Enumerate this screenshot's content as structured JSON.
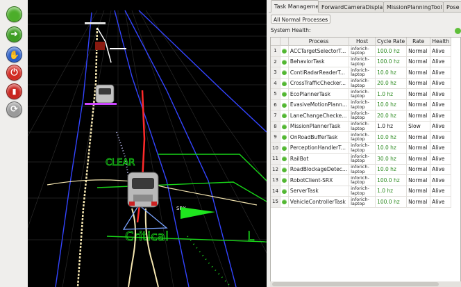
{
  "toolbar": {
    "buttons": [
      {
        "name": "go-button",
        "color": "#4cae2a",
        "icon": "circle-icon"
      },
      {
        "name": "forward-button",
        "color": "#3d9e23",
        "icon": "arrow-right-icon"
      },
      {
        "name": "pause-hand-button",
        "color": "#2a5ec8",
        "icon": "hand-icon"
      },
      {
        "name": "power-button",
        "color": "#d22a22",
        "icon": "power-icon"
      },
      {
        "name": "delete-button",
        "color": "#c8241e",
        "icon": "trash-icon"
      },
      {
        "name": "refresh-button",
        "color": "#9a9a9a",
        "icon": "refresh-icon"
      }
    ]
  },
  "viewport": {
    "clear_label": "CLEAR",
    "critical_label": "Critical",
    "lc_label": "L",
    "srx_label": "SRX"
  },
  "tabs": [
    {
      "label": "Task Management",
      "active": true
    },
    {
      "label": "ForwardCameraDisplay",
      "active": false
    },
    {
      "label": "MissionPlanningTool",
      "active": false
    },
    {
      "label": "Pose",
      "active": false
    }
  ],
  "filter": {
    "value": "All Normal Processes",
    "caret": "▾"
  },
  "system_health_label": "System Health:",
  "colors": {
    "healthy": "#52b731",
    "rate_ok": "#2c8a20"
  },
  "table": {
    "columns": [
      "",
      "Process",
      "Host",
      "Cycle Rate",
      "Rate",
      "Health"
    ],
    "rows": [
      {
        "num": "1",
        "process": "ACCTargetSelectorT...",
        "host": "inforich-laptop",
        "cycle": "100.0 hz",
        "rate": "Normal",
        "health": "Alive"
      },
      {
        "num": "2",
        "process": "BehaviorTask",
        "host": "inforich-laptop",
        "cycle": "100.0 hz",
        "rate": "Normal",
        "health": "Alive"
      },
      {
        "num": "3",
        "process": "ContiRadarReaderT...",
        "host": "inforich-laptop",
        "cycle": "10.0 hz",
        "rate": "Normal",
        "health": "Alive"
      },
      {
        "num": "4",
        "process": "CrossTrafficChecker...",
        "host": "inforich-laptop",
        "cycle": "20.0 hz",
        "rate": "Normal",
        "health": "Alive"
      },
      {
        "num": "5",
        "process": "EcoPlannerTask",
        "host": "inforich-laptop",
        "cycle": "1.0 hz",
        "rate": "Normal",
        "health": "Alive"
      },
      {
        "num": "6",
        "process": "EvasiveMotionPlann...",
        "host": "inforich-laptop",
        "cycle": "10.0 hz",
        "rate": "Normal",
        "health": "Alive"
      },
      {
        "num": "7",
        "process": "LaneChangeChecke...",
        "host": "inforich-laptop",
        "cycle": "20.0 hz",
        "rate": "Normal",
        "health": "Alive"
      },
      {
        "num": "8",
        "process": "MissionPlannerTask",
        "host": "inforich-laptop",
        "cycle": "1.0 hz",
        "rate": "Slow",
        "health": "Alive"
      },
      {
        "num": "9",
        "process": "OnRoadBufferTask",
        "host": "inforich-laptop",
        "cycle": "10.0 hz",
        "rate": "Normal",
        "health": "Alive"
      },
      {
        "num": "10",
        "process": "PerceptionHandlerT...",
        "host": "inforich-laptop",
        "cycle": "10.0 hz",
        "rate": "Normal",
        "health": "Alive"
      },
      {
        "num": "11",
        "process": "RailBot",
        "host": "inforich-laptop",
        "cycle": "30.0 hz",
        "rate": "Normal",
        "health": "Alive"
      },
      {
        "num": "12",
        "process": "RoadBlockageDetec...",
        "host": "inforich-laptop",
        "cycle": "10.0 hz",
        "rate": "Normal",
        "health": "Alive"
      },
      {
        "num": "13",
        "process": "RobotClient-SRX",
        "host": "inforich-laptop",
        "cycle": "100.0 hz",
        "rate": "Normal",
        "health": "Alive"
      },
      {
        "num": "14",
        "process": "ServerTask",
        "host": "inforich-laptop",
        "cycle": "1.0 hz",
        "rate": "Normal",
        "health": "Alive"
      },
      {
        "num": "15",
        "process": "VehicleControllerTask",
        "host": "inforich-laptop",
        "cycle": "100.0 hz",
        "rate": "Normal",
        "health": "Alive"
      }
    ]
  }
}
